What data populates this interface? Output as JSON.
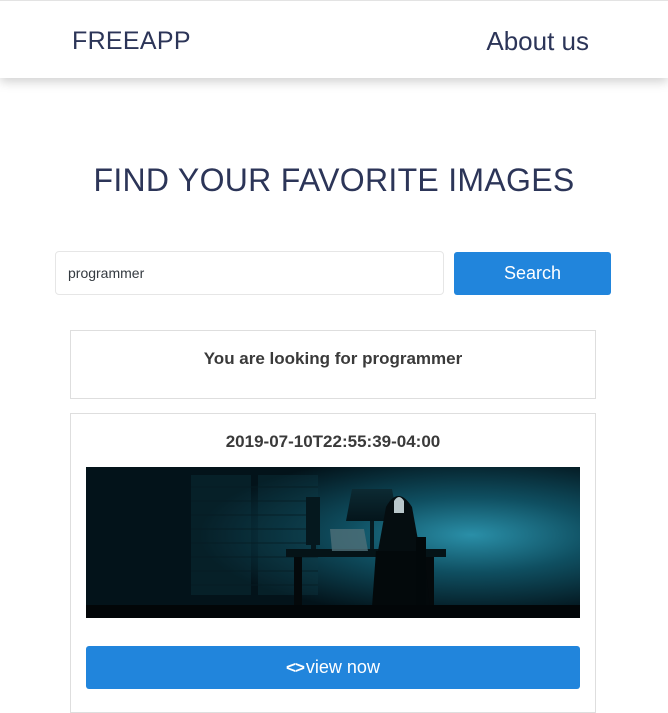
{
  "header": {
    "brand": "FREEAPP",
    "about_label": "About us"
  },
  "hero": {
    "title": "FIND YOUR FAVORITE IMAGES"
  },
  "search": {
    "value": "programmer",
    "button_label": "Search"
  },
  "results": {
    "query_message": "You are looking for programmer",
    "items": [
      {
        "date": "2019-07-10T22:55:39-04:00",
        "image_icon": "hooded-programmer-photo",
        "button_icon": "code-icon",
        "button_label": "view now"
      }
    ]
  },
  "colors": {
    "accent": "#2185dc",
    "text_dark": "#2c3558"
  }
}
